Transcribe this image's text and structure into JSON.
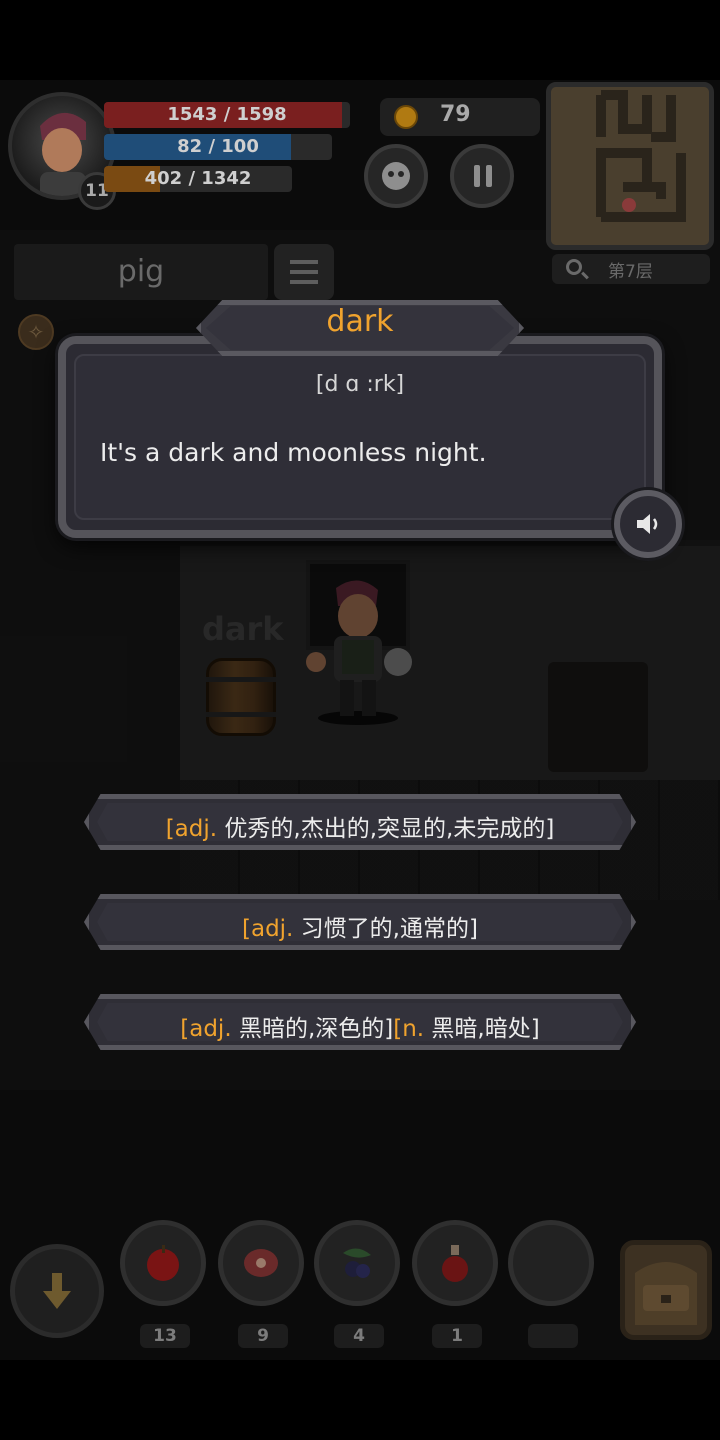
{
  "hud": {
    "hp": {
      "current": 1543,
      "max": 1598,
      "text": "1543 / 1598"
    },
    "mp": {
      "current": 82,
      "max": 100,
      "text": "82 / 100"
    },
    "xp": {
      "current": 402,
      "max": 1342,
      "text": "402 / 1342"
    },
    "level": "11",
    "coins": "79",
    "floor": "第7层"
  },
  "word_slot": "pig",
  "floor_word": "dark",
  "popup": {
    "word": "dark",
    "phonetic": "[d ɑ :rk]",
    "sentence": "It's a dark and moonless night."
  },
  "options": [
    {
      "pos": "[adj.",
      "meaning": " 优秀的,杰出的,突显的,未完成的]"
    },
    {
      "pos": "[adj.",
      "meaning": " 习惯了的,通常的]"
    },
    {
      "pos": "[adj.",
      "meaning": " 黑暗的,深色的]",
      "pos2": "[n.",
      "meaning2": " 黑暗,暗处]"
    }
  ],
  "inventory": [
    {
      "name": "apple-icon",
      "count": "13"
    },
    {
      "name": "meat-icon",
      "count": "9"
    },
    {
      "name": "berries-icon",
      "count": "4"
    },
    {
      "name": "potion-icon",
      "count": "1"
    },
    {
      "name": "empty-slot",
      "count": ""
    }
  ],
  "colors": {
    "accent": "#f0a32e",
    "hp": "#7a1f1f",
    "mp": "#1f4d78",
    "xp": "#7a4a12"
  }
}
